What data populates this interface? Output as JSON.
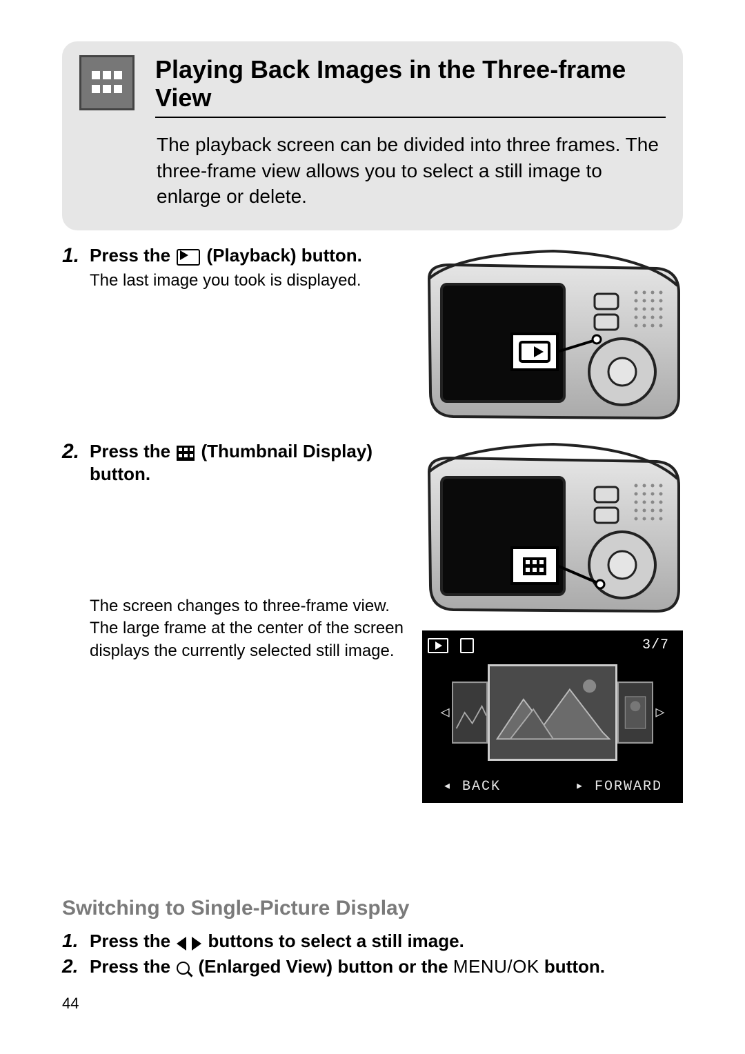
{
  "header": {
    "title": "Playing Back Images in the Three-frame View",
    "intro": "The playback screen can be divided into three frames. The three-frame view allows you to select a still image to enlarge or delete."
  },
  "steps": [
    {
      "num": "1.",
      "title_pre": "Press the ",
      "title_post": " (Playback) button.",
      "desc": "The last image you took is displayed."
    },
    {
      "num": "2.",
      "title_pre": "Press the ",
      "title_post": " (Thumbnail Display) button.",
      "desc": "The screen changes to three-frame view. The large frame at the center of the screen displays the currently selected still image."
    }
  ],
  "lcd": {
    "counter": "3/7",
    "back": "BACK",
    "forward": "FORWARD"
  },
  "subtitle": "Switching to Single-Picture Display",
  "sub_steps": [
    {
      "num": "1.",
      "title_pre": "Press the ",
      "title_post": " buttons to select a still image."
    },
    {
      "num": "2.",
      "title_pre": "Press the ",
      "title_mid": " (Enlarged View) button or the ",
      "menuok": "MENU/OK",
      "title_post": " button."
    }
  ],
  "page_number": "44"
}
